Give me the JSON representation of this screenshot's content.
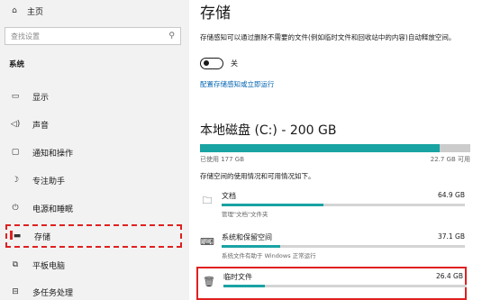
{
  "sidebar": {
    "home_label": "主页",
    "search_placeholder": "查找设置",
    "section_title": "系统",
    "items": [
      {
        "label": "显示",
        "icon": "monitor-icon"
      },
      {
        "label": "声音",
        "icon": "speaker-icon"
      },
      {
        "label": "通知和操作",
        "icon": "notification-icon"
      },
      {
        "label": "专注助手",
        "icon": "moon-icon"
      },
      {
        "label": "电源和睡眠",
        "icon": "power-icon"
      },
      {
        "label": "存储",
        "icon": "storage-icon",
        "active": true
      },
      {
        "label": "平板电脑",
        "icon": "tablet-icon"
      },
      {
        "label": "多任务处理",
        "icon": "multitask-icon"
      }
    ]
  },
  "main": {
    "title": "存储",
    "description": "存储感知可以通过删除不需要的文件(例如临时文件和回收站中的内容)自动释放空间。",
    "toggle_state": "关",
    "toggle_on": false,
    "config_link": "配置存储感知或立即运行",
    "disk": {
      "title": "本地磁盘 (C:) - 200 GB",
      "used_text": "已使用 177 GB",
      "available_text": "22.7 GB 可用",
      "used_fraction": 0.885,
      "distribution_text": "存储空间的使用情况和可用情况如下。"
    },
    "categories": [
      {
        "name": "文档",
        "size": "64.9 GB",
        "subtext": "管理\"文档\"文件夹",
        "icon": "folder-icon",
        "fraction": 0.42
      },
      {
        "name": "系统和保留空间",
        "size": "37.1 GB",
        "subtext": "系统文件有助于 Windows 正常运行",
        "icon": "laptop-icon",
        "fraction": 0.24
      },
      {
        "name": "临时文件",
        "size": "26.4 GB",
        "subtext": "",
        "icon": "trash-icon",
        "fraction": 0.17,
        "highlighted": true
      }
    ]
  },
  "colors": {
    "accent": "#1aa3a3",
    "link": "#0063b1",
    "highlight": "#e02020"
  }
}
